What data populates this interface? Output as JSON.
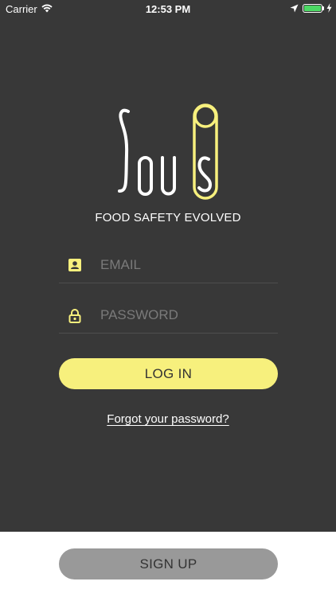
{
  "status_bar": {
    "carrier": "Carrier",
    "time": "12:53 PM",
    "icons": [
      "wifi-icon",
      "location-icon",
      "battery-icon",
      "charging-icon"
    ],
    "battery_color": "#4cd964"
  },
  "brand": {
    "logo_text": "Sous",
    "tagline": "FOOD SAFETY EVOLVED",
    "accent_color": "#f7f07d"
  },
  "login_form": {
    "email": {
      "placeholder": "EMAIL",
      "value": "",
      "icon": "contact-card-icon"
    },
    "password": {
      "placeholder": "PASSWORD",
      "value": "",
      "icon": "lock-icon"
    },
    "login_label": "LOG IN",
    "forgot_label": "Forgot your password?"
  },
  "footer": {
    "signup_label": "SIGN UP"
  }
}
